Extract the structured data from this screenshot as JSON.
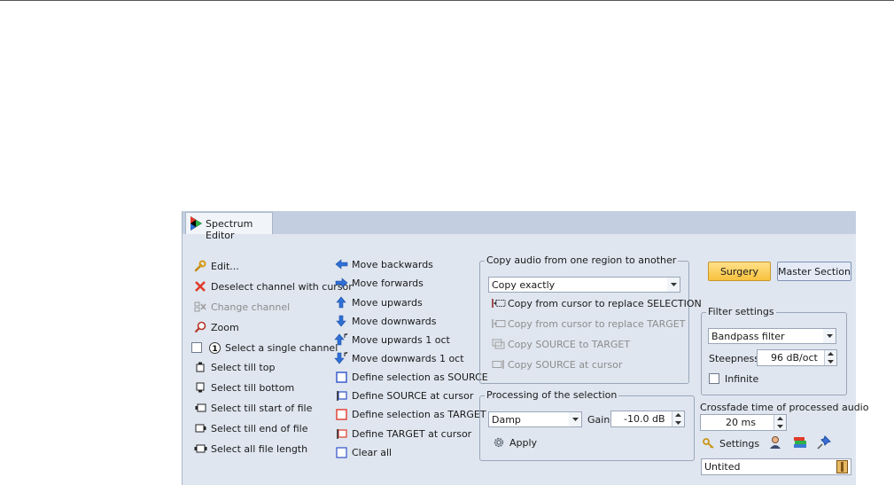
{
  "tab": {
    "label": "Spectrum Editor"
  },
  "col1": {
    "edit": "Edit...",
    "deselect": "Deselect channel with cursor",
    "change_channel": "Change channel",
    "zoom": "Zoom",
    "select_single": "Select a single channel",
    "select_top": "Select till top",
    "select_bottom": "Select till bottom",
    "select_start": "Select till start of file",
    "select_end": "Select till end of file",
    "select_all": "Select all file length"
  },
  "col2": {
    "move_back": "Move backwards",
    "move_fwd": "Move forwards",
    "move_up": "Move upwards",
    "move_down": "Move downwards",
    "move_up_oct": "Move upwards 1 oct",
    "move_down_oct": "Move downwards 1 oct",
    "def_source": "Define selection as SOURCE",
    "def_source_cursor": "Define SOURCE at cursor",
    "def_target": "Define selection as TARGET",
    "def_target_cursor": "Define TARGET at cursor",
    "clear_all": "Clear all"
  },
  "copy": {
    "title": "Copy audio from one region to another",
    "mode": "Copy exactly",
    "to_selection": "Copy from cursor to replace SELECTION",
    "to_target": "Copy from cursor to replace TARGET",
    "source_to_target": "Copy SOURCE to TARGET",
    "source_at_cursor": "Copy SOURCE at cursor"
  },
  "processing": {
    "title": "Processing of the selection",
    "mode": "Damp",
    "gain_label": "Gain",
    "gain_value": "-10.0 dB",
    "apply": "Apply"
  },
  "right": {
    "surgery": "Surgery",
    "master": "Master Section",
    "filter_title": "Filter settings",
    "filter_type": "Bandpass filter",
    "steepness_label": "Steepness",
    "steepness_value": "96 dB/oct",
    "infinite": "Infinite",
    "crossfade_label": "Crossfade time of processed audio",
    "crossfade_value": "20 ms",
    "settings": "Settings",
    "preset_name": "Untited"
  },
  "colors": {
    "panel_bg": "#dfe6f0",
    "tab_strip": "#c3cfe0",
    "accent_blue": "#2f6fd6",
    "delete_red": "#e03a2a",
    "surgery_orange": "#f8c23c"
  }
}
